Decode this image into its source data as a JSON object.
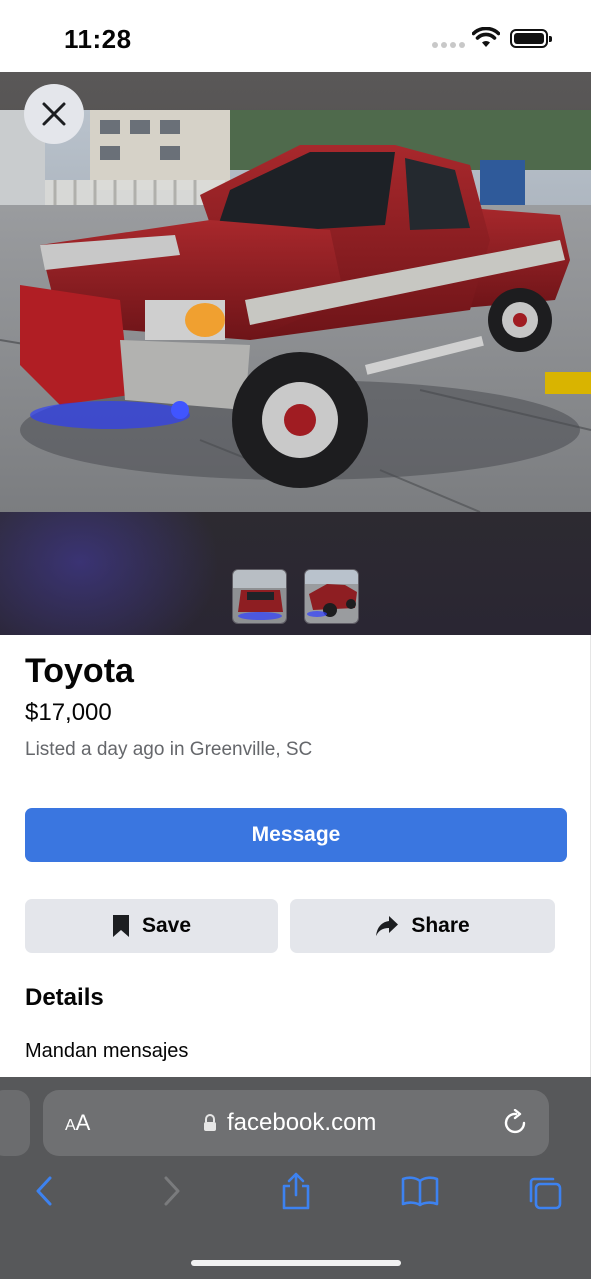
{
  "status_bar": {
    "time": "11:28"
  },
  "listing": {
    "title": "Toyota",
    "price": "$17,000",
    "meta": "Listed a day ago in Greenville, SC",
    "message_label": "Message",
    "save_label": "Save",
    "share_label": "Share",
    "details_heading": "Details",
    "details_text": "Mandan mensajes"
  },
  "media": {
    "thumbnail_count": 2,
    "close_icon": "close-icon"
  },
  "browser": {
    "text_size_label_small": "A",
    "text_size_label_large": "A",
    "url": "facebook.com"
  },
  "colors": {
    "accent": "#3a76e0",
    "secondary_button": "#e4e6eb",
    "browser_chrome": "#57585a",
    "ios_blue": "#3d82f0",
    "truck_red": "#8e1e22"
  }
}
